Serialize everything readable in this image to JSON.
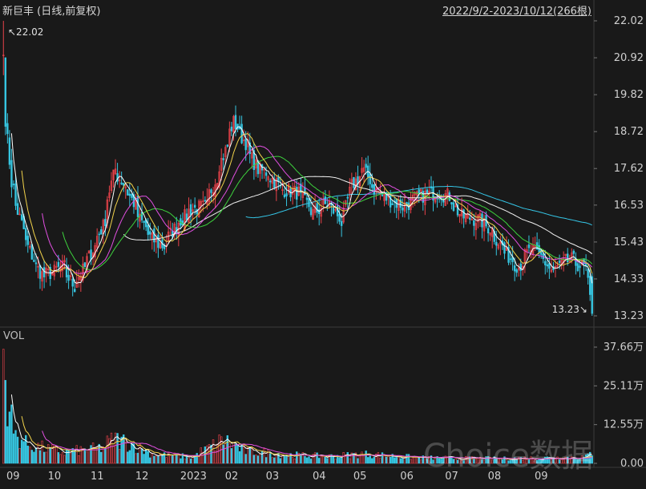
{
  "header": {
    "title": "新巨丰 (日线,前复权)",
    "range": "2022/9/2-2023/10/12(266根)"
  },
  "volume_panel": {
    "label": "VOL"
  },
  "watermark": "Choice数据",
  "colors": {
    "background": "#191919",
    "up": "#e8424a",
    "down": "#36c5e0",
    "ma5": "#ffffff",
    "ma10": "#f2d34b",
    "ma20": "#e04fe0",
    "ma30": "#3dd23d",
    "ma60": "#f0f0f0",
    "ma120": "#35c7e8",
    "ma250": "#e6e6e6",
    "grid": "#3a3a3a"
  },
  "chart_data": [
    {
      "type": "candlestick",
      "title": "新巨丰 (日线,前复权)",
      "y_ticks": [
        "22.02",
        "20.92",
        "19.82",
        "18.72",
        "17.62",
        "16.53",
        "15.43",
        "14.33",
        "13.23"
      ],
      "ylim": [
        13.23,
        22.02
      ],
      "x_ticks": [
        "09",
        "10",
        "11",
        "12",
        "2023",
        "02",
        "03",
        "04",
        "05",
        "06",
        "07",
        "08",
        "09"
      ],
      "annotations": {
        "high": "22.02",
        "low": "13.23"
      },
      "close_path": [
        [
          "2022-09-02",
          21.0
        ],
        [
          "2022-09-08",
          17.2
        ],
        [
          "2022-09-16",
          15.8
        ],
        [
          "2022-09-23",
          14.9
        ],
        [
          "2022-09-30",
          14.4
        ],
        [
          "2022-10-14",
          14.7
        ],
        [
          "2022-10-21",
          14.1
        ],
        [
          "2022-10-31",
          14.9
        ],
        [
          "2022-11-10",
          15.9
        ],
        [
          "2022-11-18",
          17.6
        ],
        [
          "2022-11-28",
          16.9
        ],
        [
          "2022-12-06",
          16.1
        ],
        [
          "2022-12-14",
          15.5
        ],
        [
          "2022-12-22",
          15.3
        ],
        [
          "2022-12-30",
          15.9
        ],
        [
          "2023-01-10",
          16.4
        ],
        [
          "2023-01-20",
          16.5
        ],
        [
          "2023-02-01",
          18.0
        ],
        [
          "2023-02-08",
          19.0
        ],
        [
          "2023-02-16",
          18.4
        ],
        [
          "2023-02-24",
          17.6
        ],
        [
          "2023-03-03",
          17.5
        ],
        [
          "2023-03-13",
          17.0
        ],
        [
          "2023-03-24",
          16.9
        ],
        [
          "2023-04-04",
          16.3
        ],
        [
          "2023-04-14",
          16.6
        ],
        [
          "2023-04-24",
          16.0
        ],
        [
          "2023-04-28",
          16.9
        ],
        [
          "2023-05-08",
          17.6
        ],
        [
          "2023-05-16",
          17.0
        ],
        [
          "2023-05-25",
          16.7
        ],
        [
          "2023-06-05",
          16.5
        ],
        [
          "2023-06-16",
          16.8
        ],
        [
          "2023-06-28",
          16.9
        ],
        [
          "2023-07-06",
          16.8
        ],
        [
          "2023-07-14",
          16.2
        ],
        [
          "2023-07-26",
          16.1
        ],
        [
          "2023-08-04",
          15.8
        ],
        [
          "2023-08-14",
          15.1
        ],
        [
          "2023-08-23",
          14.7
        ],
        [
          "2023-08-31",
          15.2
        ],
        [
          "2023-09-08",
          15.0
        ],
        [
          "2023-09-15",
          14.5
        ],
        [
          "2023-09-22",
          14.8
        ],
        [
          "2023-09-28",
          14.9
        ],
        [
          "2023-10-09",
          14.6
        ],
        [
          "2023-10-12",
          13.3
        ]
      ]
    },
    {
      "type": "bar",
      "title": "VOL",
      "y_ticks": [
        "37.66万",
        "25.11万",
        "12.55万",
        "0.00"
      ],
      "ylim": [
        0,
        37.66
      ],
      "unit": "万",
      "volume_path": [
        [
          "2022-09-02",
          37.0
        ],
        [
          "2022-09-09",
          10.0
        ],
        [
          "2022-09-20",
          6.0
        ],
        [
          "2022-10-14",
          3.5
        ],
        [
          "2022-11-10",
          5.0
        ],
        [
          "2022-11-18",
          8.0
        ],
        [
          "2022-11-28",
          6.5
        ],
        [
          "2022-12-14",
          3.0
        ],
        [
          "2023-01-10",
          2.0
        ],
        [
          "2023-02-01",
          7.5
        ],
        [
          "2023-02-16",
          4.0
        ],
        [
          "2023-03-15",
          2.8
        ],
        [
          "2023-04-14",
          2.2
        ],
        [
          "2023-05-08",
          3.0
        ],
        [
          "2023-06-16",
          1.8
        ],
        [
          "2023-07-14",
          1.6
        ],
        [
          "2023-08-14",
          1.5
        ],
        [
          "2023-09-15",
          1.8
        ],
        [
          "2023-10-09",
          2.0
        ],
        [
          "2023-10-12",
          3.5
        ]
      ]
    }
  ]
}
